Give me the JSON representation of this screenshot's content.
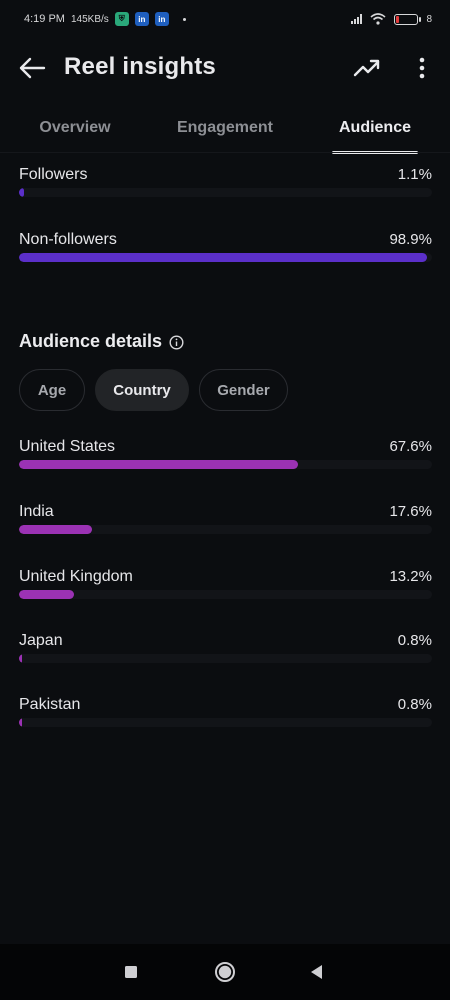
{
  "status_bar": {
    "time": "4:19 PM",
    "net_speed": "145KB/s",
    "battery": "8"
  },
  "header": {
    "title": "Reel insights"
  },
  "tabs": [
    {
      "label": "Overview",
      "active": false
    },
    {
      "label": "Engagement",
      "active": false
    },
    {
      "label": "Audience",
      "active": true
    }
  ],
  "follower_split": [
    {
      "label": "Followers",
      "value": "1.1%",
      "percent": 1.1
    },
    {
      "label": "Non-followers",
      "value": "98.9%",
      "percent": 98.9
    }
  ],
  "audience_details": {
    "title": "Audience details",
    "chips": [
      {
        "label": "Age",
        "selected": false
      },
      {
        "label": "Country",
        "selected": true
      },
      {
        "label": "Gender",
        "selected": false
      }
    ],
    "countries": [
      {
        "label": "United States",
        "value": "67.6%",
        "percent": 67.6
      },
      {
        "label": "India",
        "value": "17.6%",
        "percent": 17.6
      },
      {
        "label": "United Kingdom",
        "value": "13.2%",
        "percent": 13.2
      },
      {
        "label": "Japan",
        "value": "0.8%",
        "percent": 0.8
      },
      {
        "label": "Pakistan",
        "value": "0.8%",
        "percent": 0.8
      }
    ]
  },
  "colors": {
    "followers_bar": "#5b2fc9",
    "country_bar": "#9b32b4",
    "background": "#0b0d10"
  },
  "icons": {
    "back": "arrow-left-icon",
    "trend": "trending-up-icon",
    "more": "more-vertical-icon",
    "info": "info-icon"
  }
}
